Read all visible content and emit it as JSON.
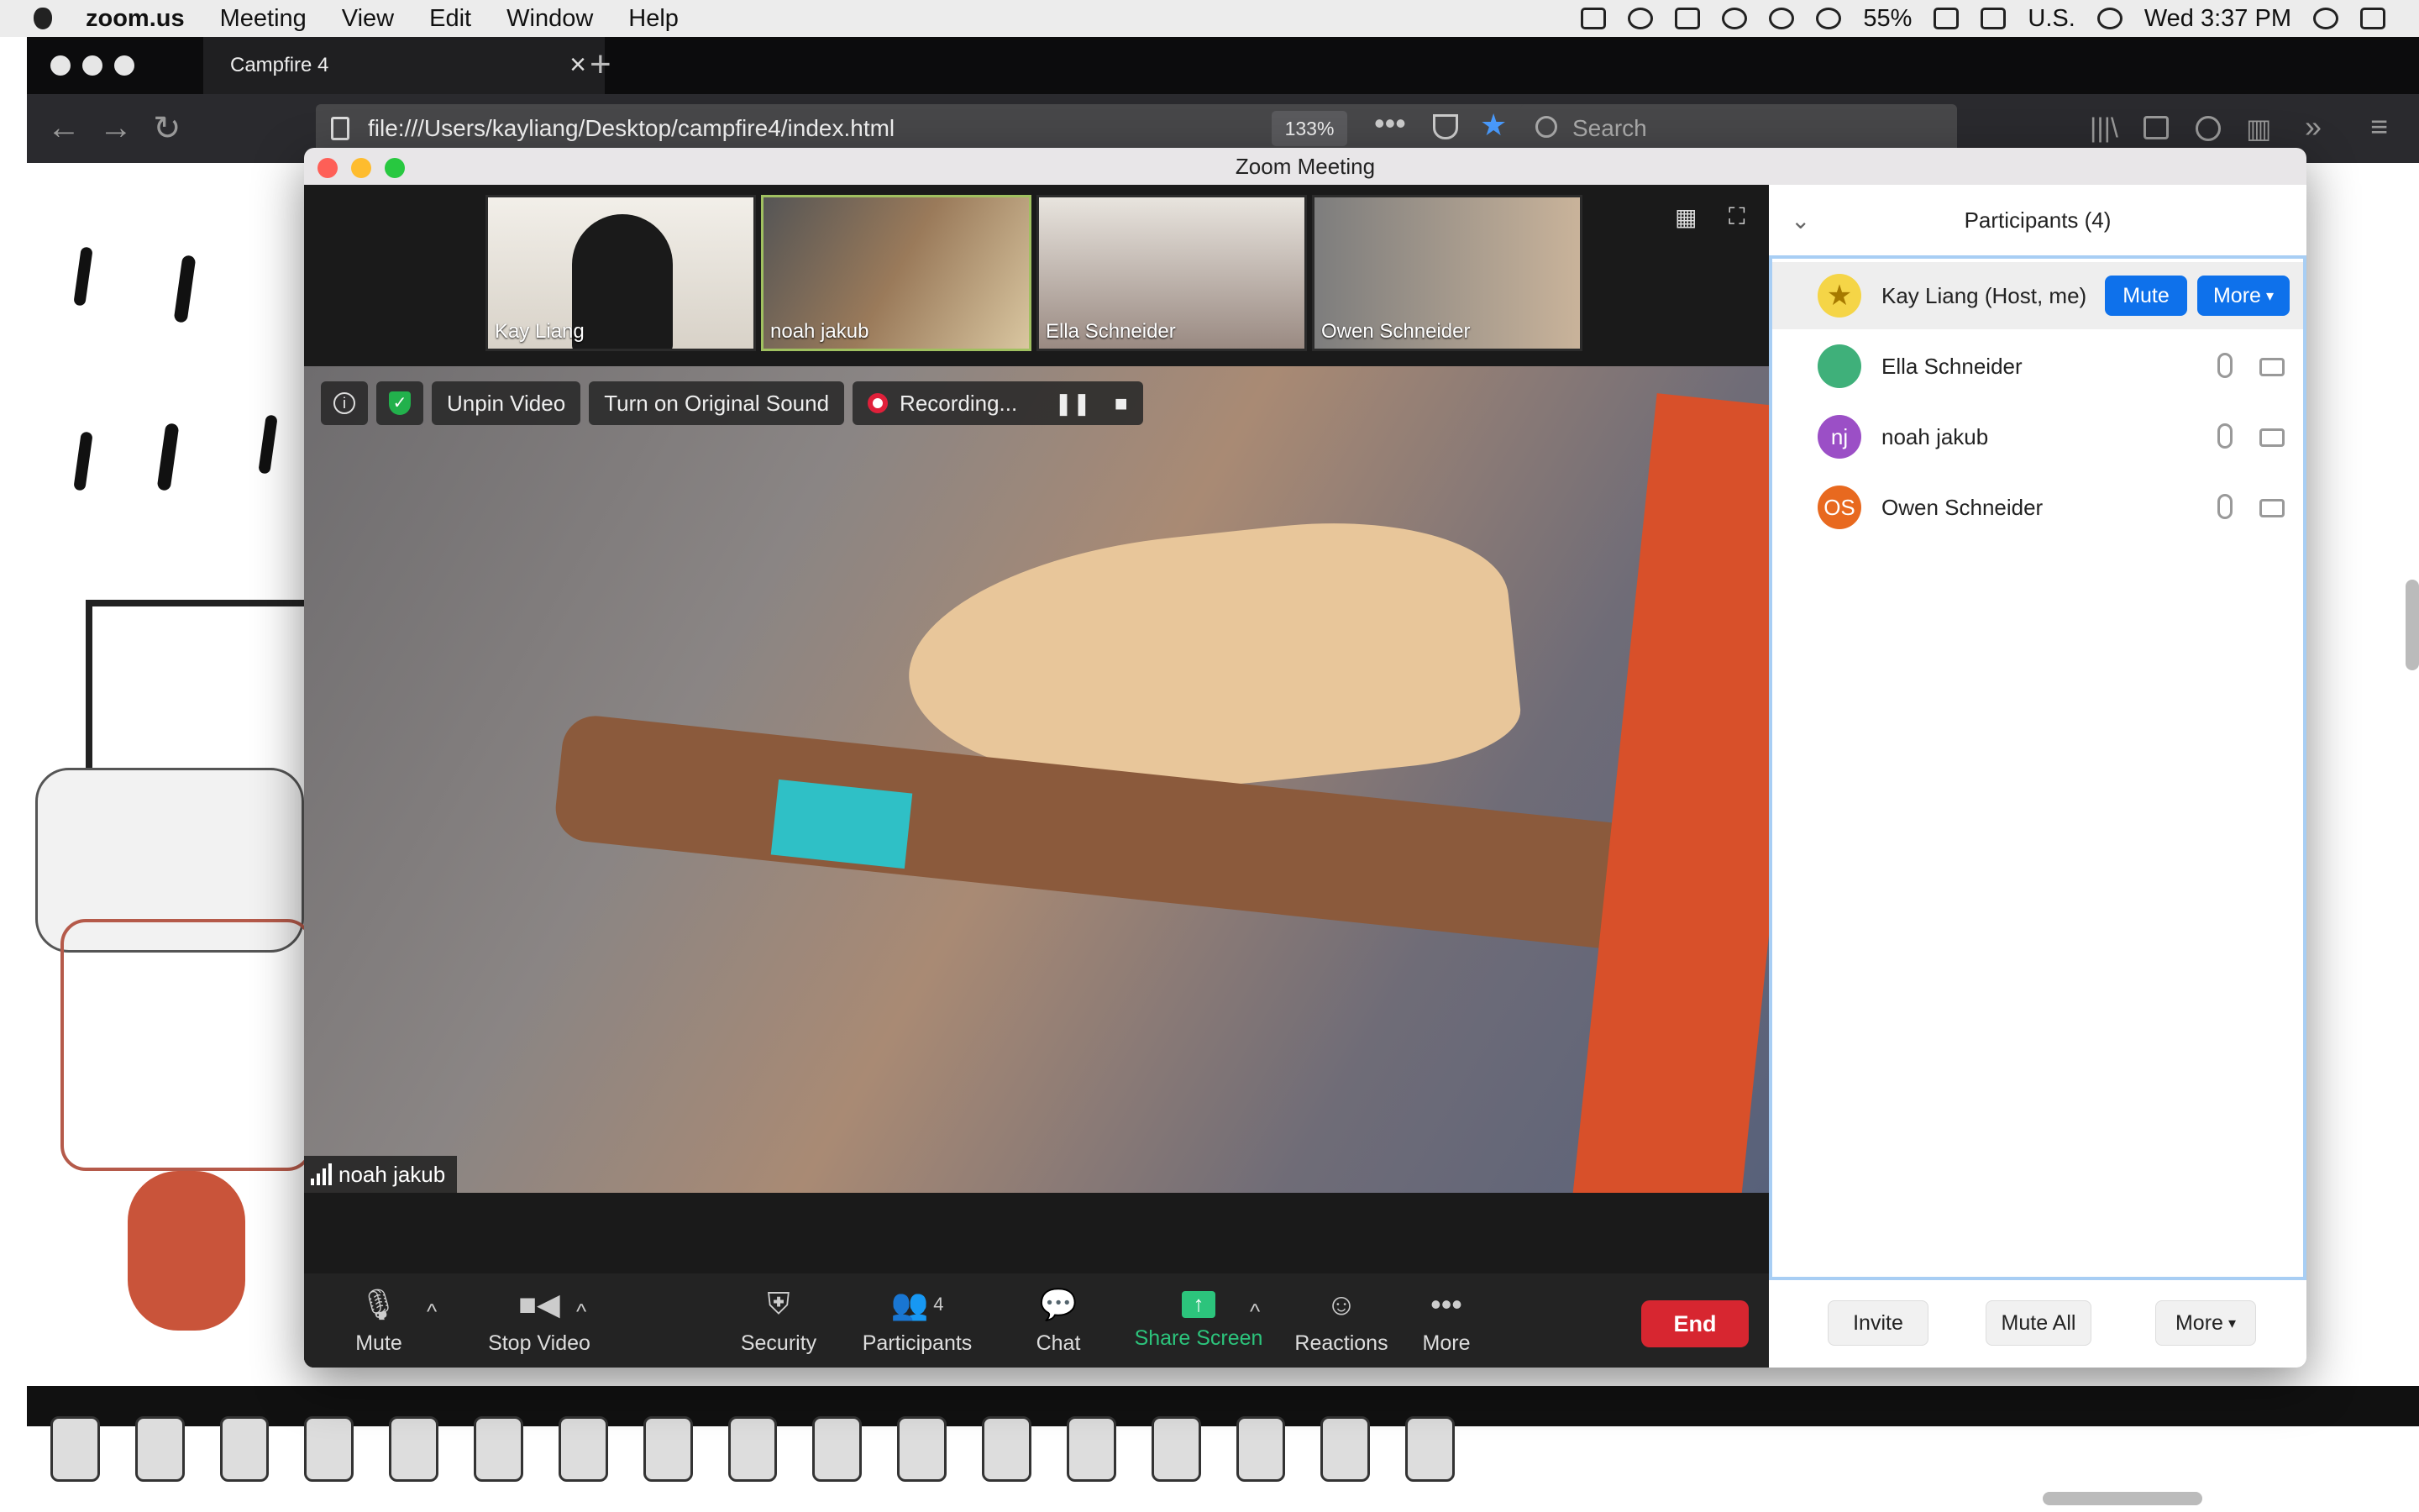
{
  "menubar": {
    "app_name": "zoom.us",
    "menus": [
      "Meeting",
      "View",
      "Edit",
      "Window",
      "Help"
    ],
    "battery": "55%",
    "input_source": "U.S.",
    "clock": "Wed 3:37 PM"
  },
  "browser": {
    "tab_title": "Campfire 4",
    "url": "file:///Users/kayliang/Desktop/campfire4/index.html",
    "zoom_level": "133%",
    "search_placeholder": "Search"
  },
  "zoom": {
    "window_title": "Zoom Meeting",
    "thumbnails": [
      {
        "name": "Kay Liang",
        "active": false
      },
      {
        "name": "noah jakub",
        "active": true
      },
      {
        "name": "Ella Schneider",
        "active": false
      },
      {
        "name": "Owen    Schneider",
        "active": false
      }
    ],
    "controls": {
      "unpin": "Unpin Video",
      "original_sound": "Turn on Original Sound",
      "recording": "Recording..."
    },
    "active_speaker": "noah jakub",
    "toolbar": {
      "mute": "Mute",
      "stop_video": "Stop Video",
      "security": "Security",
      "participants": "Participants",
      "participants_count": "4",
      "chat": "Chat",
      "share_screen": "Share Screen",
      "reactions": "Reactions",
      "more": "More",
      "end": "End"
    },
    "participants_panel": {
      "title": "Participants (4)",
      "people": [
        {
          "name": "Kay Liang (Host, me)",
          "initials": "",
          "avatar_color": "#f5d547"
        },
        {
          "name": "Ella Schneider",
          "initials": "",
          "avatar_color": "#3fb07a"
        },
        {
          "name": "noah jakub",
          "initials": "nj",
          "avatar_color": "#9b4fc6"
        },
        {
          "name": "Owen    Schneider",
          "initials": "OS",
          "avatar_color": "#e8691f"
        }
      ],
      "mute_button": "Mute",
      "more_button": "More",
      "footer": {
        "invite": "Invite",
        "mute_all": "Mute All",
        "more": "More"
      }
    },
    "colors": {
      "accent": "#0e71eb",
      "end": "#d72630",
      "share": "#2cc47c",
      "recording": "#e0203a"
    }
  }
}
